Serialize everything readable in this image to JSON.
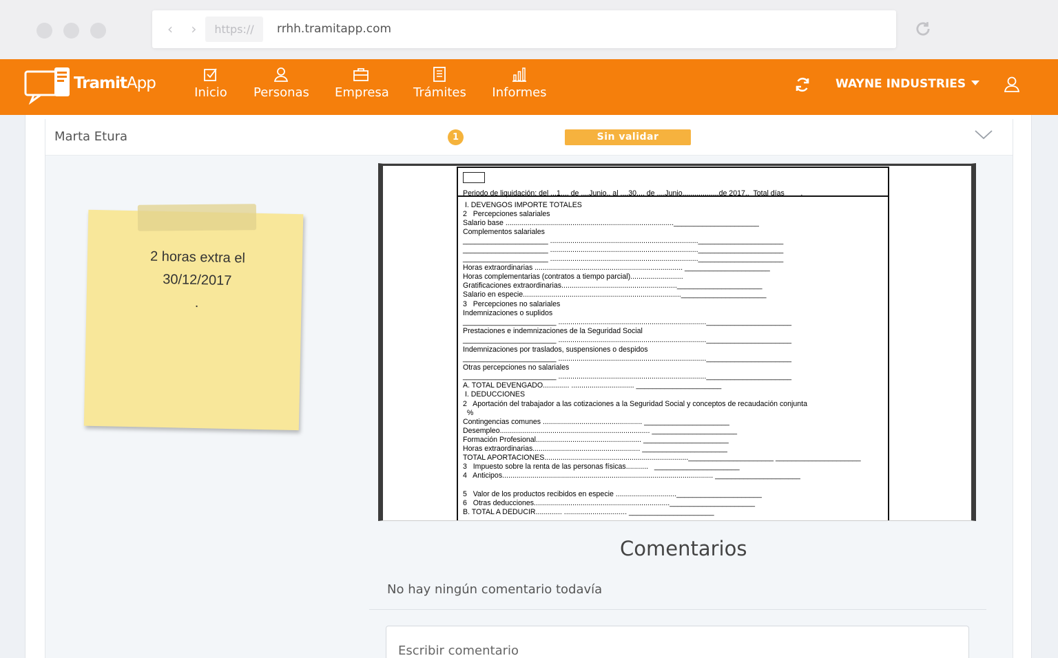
{
  "browser": {
    "nav_arrows": "‹ ›",
    "scheme": "https://",
    "url": "rrhh.tramitapp.com"
  },
  "header": {
    "logo_primary": "Tramit",
    "logo_secondary": "App",
    "nav": [
      {
        "label": "Inicio",
        "icon": "checkbox-icon"
      },
      {
        "label": "Personas",
        "icon": "person-icon"
      },
      {
        "label": "Empresa",
        "icon": "briefcase-icon"
      },
      {
        "label": "Trámites",
        "icon": "document-icon"
      },
      {
        "label": "Informes",
        "icon": "bar-chart-icon"
      }
    ],
    "company": "WAYNE INDUSTRIES",
    "accent_color": "#f57f0c"
  },
  "record": {
    "name": "Marta Etura",
    "count": "1",
    "status": "Sin validar",
    "status_color": "#f6b23e"
  },
  "note": {
    "line1": "2 horas extra el",
    "line2": "30/12/2017",
    "line3": "."
  },
  "document": {
    "lines": [
      "Periodo de liquidación: del ...1.... de ....Junio.. al ....30.... de ....Junio..................de 2017..  Total días        .",
      " I. DEVENGOS IMPORTE TOTALES",
      "2   Percepciones salariales",
      "Salario base ..................................................................................._____________________",
      "Complementos salariales",
      "_____________________ ........................................................................._____________________",
      "_____________________ ........................................................................._____________________",
      "_____________________ ........................................................................._____________________",
      "Horas extraordinarias ......................................................................... _____________________",
      "Horas complementarias (contratos a tiempo parcial)..........................",
      "Gratificaciones extraordinarias........................................................._____________________",
      "Salario en especie.............................................................................._____________________",
      "3   Percepciones no salariales",
      "Indemnizaciones o suplidos",
      "_______________________ ........................................................................._____________________",
      "Prestaciones e indemnizaciones de la Seguridad Social",
      "_______________________ ........................................................................._____________________",
      "Indemnizaciones por traslados, suspensiones o despidos",
      "_______________________ ........................................................................._____________________",
      "Otras percepciones no salariales",
      "_______________________ ........................................................................._____________________",
      "A. TOTAL DEVENGADO............. ............................... _____________________",
      " I. DEDUCCIONES",
      "2   Aportación del trabajador a las cotizaciones a la Seguridad Social y conceptos de recaudación conjunta",
      "  %",
      "Contingencias comunes ................................................. _____________________",
      "Desempleo.......................................................................... _____________________",
      "Formación Profesional.................................................... _____________________",
      "Horas extraordinarias..................................................... _____________________",
      "TOTAL APORTACIONES......................................................................._____________________ _____________________",
      "3   Impuesto sobre la renta de las personas físicas...........   _____________________",
      "4   Anticipos........................................................................................................ _____________________",
      "",
      "5   Valor de los productos recibidos en especie .............................._____________________",
      "6   Otras deducciones..................................................................._____________________",
      "B. TOTAL A DEDUCIR............. ............................... _____________________"
    ]
  },
  "comments": {
    "title": "Comentarios",
    "empty_text": "No hay ningún comentario todavía",
    "input_placeholder": "Escribir comentario"
  }
}
